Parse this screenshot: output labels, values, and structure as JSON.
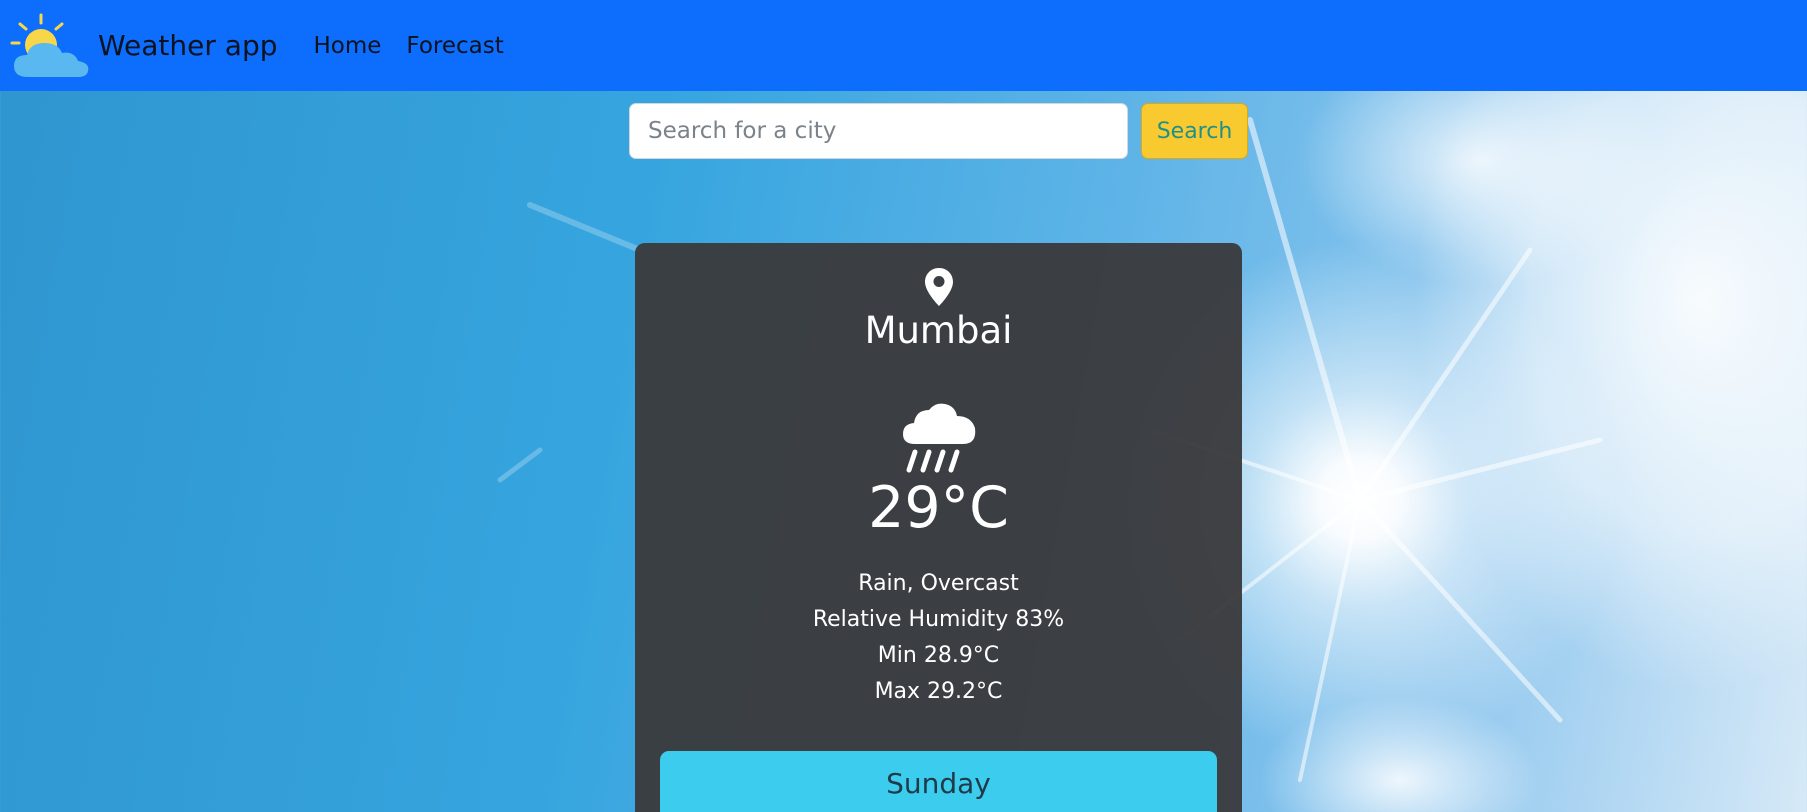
{
  "navbar": {
    "brand_text": "Weather app",
    "links": [
      {
        "label": "Home"
      },
      {
        "label": "Forecast"
      }
    ],
    "logo_icon": "sun-behind-cloud-icon",
    "background_color": "#0d6efd"
  },
  "search": {
    "placeholder": "Search for a city",
    "value": "",
    "button_label": "Search",
    "button_color": "#f9c930"
  },
  "weather_card": {
    "location_icon": "map-pin-icon",
    "city": "Mumbai",
    "condition_icon": "cloud-rain-icon",
    "temperature": "29°C",
    "condition": "Rain, Overcast",
    "humidity": "Relative Humidity 83%",
    "min_temp": "Min 28.9°C",
    "max_temp": "Max 29.2°C",
    "day_tab": "Sunday",
    "day_tab_color": "#3ccdee"
  }
}
